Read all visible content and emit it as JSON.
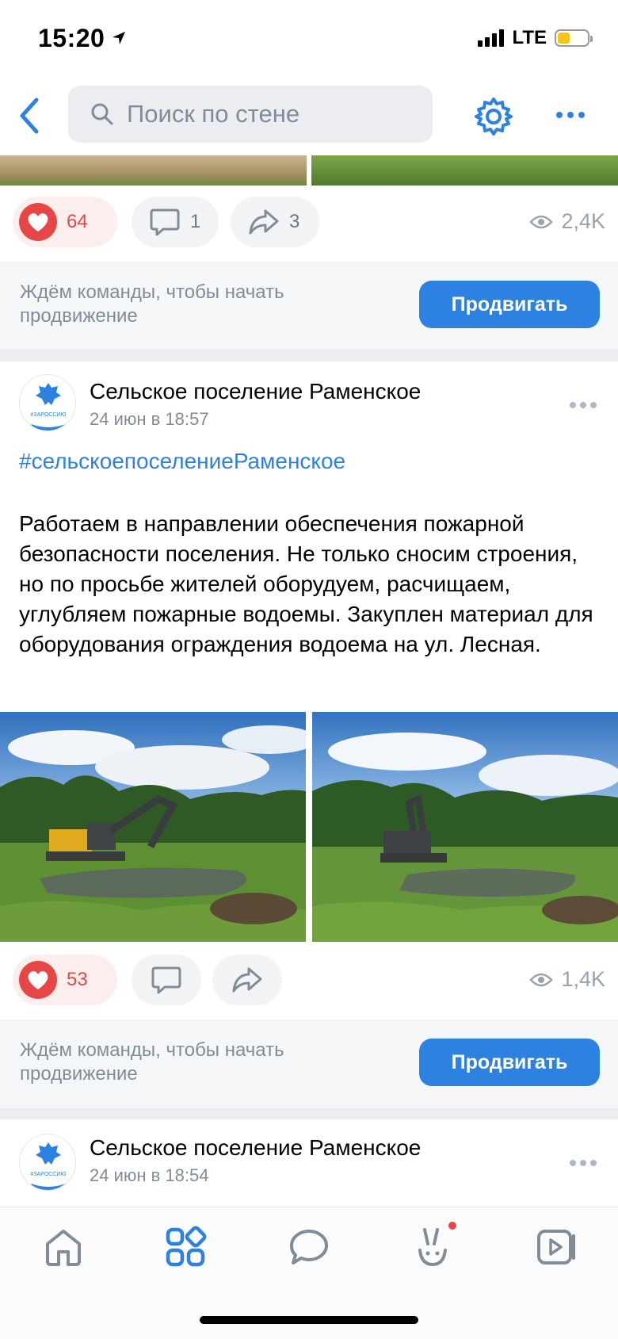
{
  "status_bar": {
    "time": "15:20",
    "network": "LTE"
  },
  "search": {
    "placeholder": "Поиск по стене"
  },
  "posts": [
    {
      "likes": "64",
      "comments": "1",
      "shares": "3",
      "views": "2,4K"
    },
    {
      "author": "Сельское поселение Раменское",
      "date": "24 июн в 18:57",
      "avatar_text": "#ЗАРОССИЮ",
      "hashtag": "#сельскоепоселениеРаменское",
      "text": "Работаем в направлении обеспечения пожарной безопасности поселения. Не только сносим строения, но по просьбе жителей оборудуем, расчищаем, углубляем пожарные водоемы. Закуплен материал для оборудования ограждения водоема на ул. Лесная.",
      "likes": "53",
      "views": "1,4K"
    },
    {
      "author": "Сельское поселение Раменское",
      "date": "24 июн в 18:54",
      "avatar_text": "#ЗАРОССИЮ"
    }
  ],
  "promo": {
    "text": "Ждём команды, чтобы начать продвижение",
    "button": "Продвигать"
  },
  "colors": {
    "accent": "#2d81e0",
    "like": "#e64646",
    "notification_dot": "#e64646"
  },
  "tab_bar": {
    "icons": [
      "home-icon",
      "services-icon",
      "messages-icon",
      "clips-icon",
      "video-icon"
    ]
  }
}
